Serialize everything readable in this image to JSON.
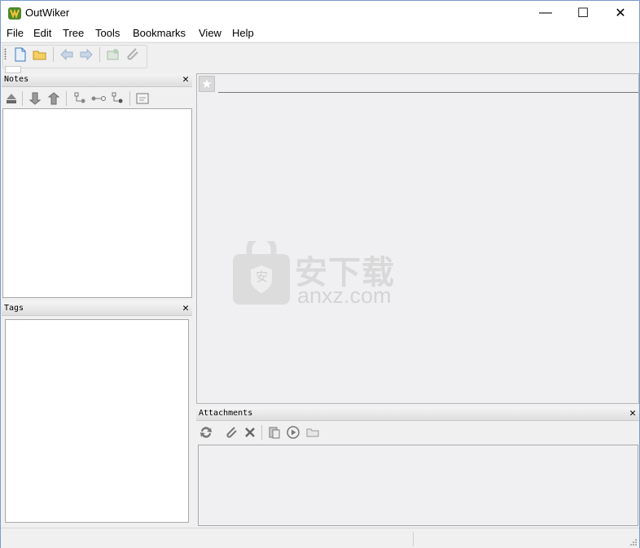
{
  "window": {
    "title": "OutWiker",
    "minimize_glyph": "—",
    "maximize_glyph": "☐",
    "close_glyph": "✕"
  },
  "menu": [
    "File",
    "Edit",
    "Tree",
    "Tools",
    "Bookmarks",
    "View",
    "Help"
  ],
  "toolbar_icons": [
    "new-file-icon",
    "open-folder-icon",
    "back-arrow-icon",
    "forward-arrow-icon",
    "reload-icon",
    "attach-icon"
  ],
  "panels": {
    "notes": {
      "title": "Notes",
      "close": "✕"
    },
    "tags": {
      "title": "Tags",
      "close": "✕"
    },
    "attachments": {
      "title": "Attachments",
      "close": "✕"
    }
  },
  "main": {
    "bookmark_star": "★"
  },
  "watermark": {
    "text": "安下载",
    "domain": "anxz.com",
    "badge": "安"
  }
}
